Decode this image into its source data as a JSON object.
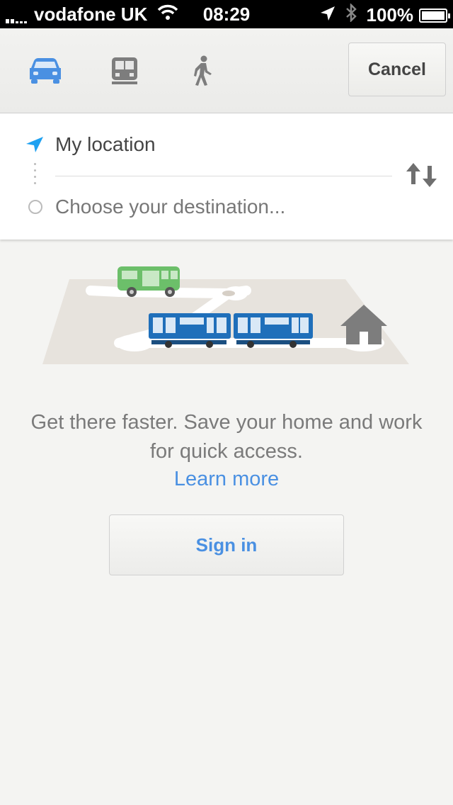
{
  "status_bar": {
    "carrier": "vodafone UK",
    "time": "08:29",
    "battery": "100%"
  },
  "modes": [
    {
      "name": "car",
      "icon": "car-icon",
      "selected": true
    },
    {
      "name": "transit",
      "icon": "train-icon",
      "selected": false
    },
    {
      "name": "walk",
      "icon": "walking-person-icon",
      "selected": false
    }
  ],
  "header": {
    "cancel_label": "Cancel"
  },
  "route": {
    "origin": "My location",
    "destination_placeholder": "Choose your destination..."
  },
  "promo": {
    "message": "Get there faster. Save your home and work for quick access.",
    "learn_more": "Learn more",
    "sign_in_label": "Sign in"
  },
  "colors": {
    "accent": "#4a90e2",
    "location_arrow": "#1ea1f1",
    "bus_green": "#6cbf6a",
    "train_blue": "#1f6fba"
  }
}
